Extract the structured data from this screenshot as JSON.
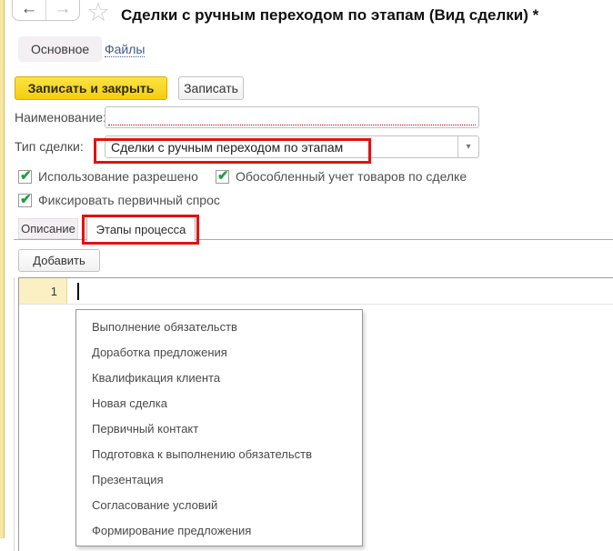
{
  "window": {
    "title": "Сделки с ручным переходом по этапам (Вид сделки) *"
  },
  "icons": {
    "back": "←",
    "forward": "→",
    "star": "☆",
    "check": "✔",
    "dropdown_arrow": "▾"
  },
  "nav": {
    "main_tab_label": "Основное",
    "files_link_label": "Файлы"
  },
  "toolbar": {
    "save_close_label": "Записать и закрыть",
    "save_label": "Записать"
  },
  "form": {
    "name_label": "Наименование:",
    "name_value": "",
    "deal_type_label": "Тип сделки:",
    "deal_type_value": "Сделки с ручным переходом по этапам",
    "checkboxes": [
      {
        "label": "Использование разрешено",
        "checked": true
      },
      {
        "label": "Обособленный учет товаров по сделке",
        "checked": true
      },
      {
        "label": "Фиксировать первичный спрос",
        "checked": true
      }
    ]
  },
  "detail_tabs": {
    "description_label": "Описание",
    "stages_label": "Этапы процесса"
  },
  "stages": {
    "add_button_label": "Добавить",
    "row_number": "1",
    "dropdown_options": [
      "Выполнение обязательств",
      "Доработка предложения",
      "Квалификация клиента",
      "Новая сделка",
      "Первичный контакт",
      "Подготовка к выполнению обязательств",
      "Презентация",
      "Согласование условий",
      "Формирование предложения"
    ]
  },
  "colors": {
    "accent_yellow": "#f5cd0d",
    "annotation_red": "#e01212",
    "check_green": "#1e9e3e",
    "link_blue": "#3f5c8c",
    "row_number_bg": "#fbf0c4"
  }
}
